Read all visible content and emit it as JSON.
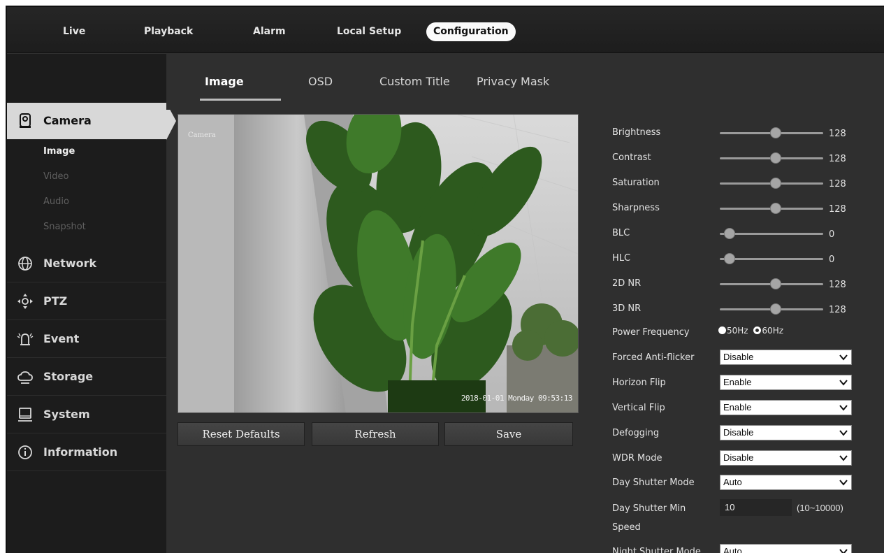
{
  "top_nav": [
    "Live",
    "Playback",
    "Alarm",
    "Local Setup",
    "Configuration"
  ],
  "tabs": [
    "Image",
    "OSD",
    "Custom Title",
    "Privacy Mask"
  ],
  "sidebar": {
    "camera": "Camera",
    "camera_sub": [
      "Image",
      "Video",
      "Audio",
      "Snapshot"
    ],
    "categories": [
      "Network",
      "PTZ",
      "Event",
      "Storage",
      "System",
      "Information"
    ]
  },
  "preview": {
    "channel_name": "Camera",
    "timestamp": "2018-01-01 Monday 09:53:13"
  },
  "buttons": {
    "reset": "Reset Defaults",
    "refresh": "Refresh",
    "save": "Save"
  },
  "settings": {
    "sliders": [
      {
        "label": "Brightness",
        "value": "128",
        "level": 0.5
      },
      {
        "label": "Contrast",
        "value": "128",
        "level": 0.5
      },
      {
        "label": "Saturation",
        "value": "128",
        "level": 0.5
      },
      {
        "label": "Sharpness",
        "value": "128",
        "level": 0.5
      },
      {
        "label": "BLC",
        "value": "0",
        "level": 0
      },
      {
        "label": "HLC",
        "value": "0",
        "level": 0
      },
      {
        "label": "2D NR",
        "value": "128",
        "level": 0.5
      },
      {
        "label": "3D NR",
        "value": "128",
        "level": 0.5
      }
    ],
    "power_frequency": {
      "label": "Power Frequency",
      "option_50": "50Hz",
      "option_60": "60Hz"
    },
    "selects": [
      {
        "label": "Forced Anti-flicker",
        "value": "Disable"
      },
      {
        "label": "Horizon Flip",
        "value": "Enable"
      },
      {
        "label": "Vertical Flip",
        "value": "Enable"
      },
      {
        "label": "Defogging",
        "value": "Disable"
      },
      {
        "label": "WDR Mode",
        "value": "Disable"
      },
      {
        "label": "Day Shutter Mode",
        "value": "Auto"
      }
    ],
    "day_shutter_min": {
      "label_line1": "Day Shutter Min",
      "label_line2": "Speed",
      "value": "10",
      "range": "(10~10000)"
    },
    "night_shutter": {
      "label": "Night Shutter Mode",
      "value": "Auto"
    }
  }
}
